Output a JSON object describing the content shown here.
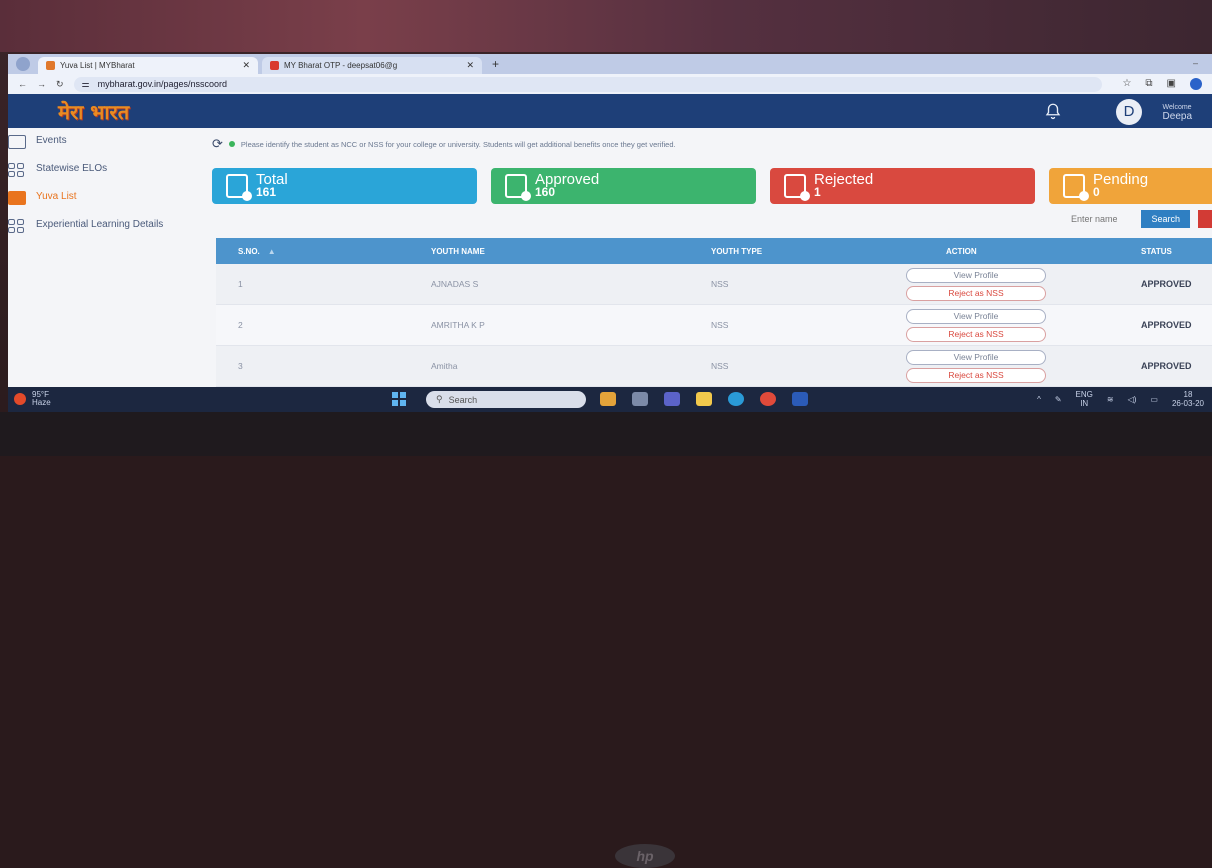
{
  "browser": {
    "tabs": [
      {
        "title": "Yuva List | MYBharat",
        "active": true
      },
      {
        "title": "MY Bharat OTP - deepsat06@g",
        "active": false
      }
    ],
    "url": "mybharat.gov.in/pages/nsscoord"
  },
  "header": {
    "logo_text": "मेरा भारत",
    "welcome": "Welcome",
    "user": "Deepa",
    "avatar_letter": "D"
  },
  "sidebar": {
    "items": [
      {
        "label": "Events",
        "icon": "events-icon"
      },
      {
        "label": "Statewise ELOs",
        "icon": "grid-icon"
      },
      {
        "label": "Yuva List",
        "icon": "list-icon",
        "active": true
      },
      {
        "label": "Experiential Learning Details",
        "icon": "grid-icon"
      }
    ]
  },
  "main": {
    "notice": "Please identify the student as NCC or NSS for your college or university. Students will get additional benefits once they get verified.",
    "cards": [
      {
        "label": "Total",
        "count": "161",
        "color": "#2aa5d8"
      },
      {
        "label": "Approved",
        "count": "160",
        "color": "#3cb46e"
      },
      {
        "label": "Rejected",
        "count": "1",
        "color": "#d9493f"
      },
      {
        "label": "Pending",
        "count": "0",
        "color": "#f0a43a"
      }
    ],
    "search": {
      "placeholder": "Enter name",
      "button": "Search"
    }
  },
  "table": {
    "headers": [
      "S.NO.",
      "YOUTH NAME",
      "YOUTH TYPE",
      "ACTION",
      "STATUS"
    ],
    "rows": [
      {
        "sno": "1",
        "name": "AJNADAS S",
        "type": "NSS",
        "view": "View Profile",
        "reject": "Reject as NSS",
        "status": "APPROVED"
      },
      {
        "sno": "2",
        "name": "AMRITHA K P",
        "type": "NSS",
        "view": "View Profile",
        "reject": "Reject as NSS",
        "status": "APPROVED"
      },
      {
        "sno": "3",
        "name": "Amitha",
        "type": "NSS",
        "view": "View Profile",
        "reject": "Reject as NSS",
        "status": "APPROVED"
      }
    ]
  },
  "taskbar": {
    "temperature": "95°F",
    "weather": "Haze",
    "search": "Search",
    "lang": "ENG",
    "region": "IN",
    "time": "18",
    "date": "26-03-20"
  }
}
